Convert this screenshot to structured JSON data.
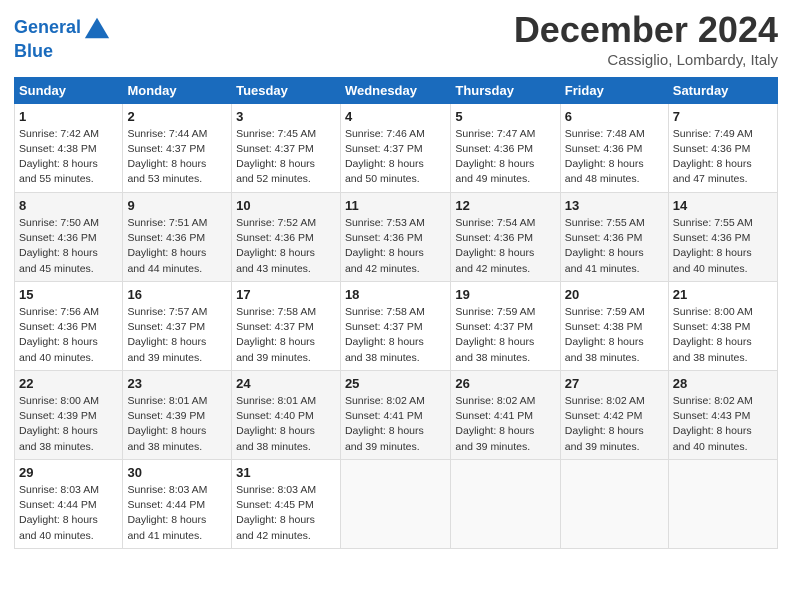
{
  "header": {
    "logo_line1": "General",
    "logo_line2": "Blue",
    "month": "December 2024",
    "location": "Cassiglio, Lombardy, Italy"
  },
  "weekdays": [
    "Sunday",
    "Monday",
    "Tuesday",
    "Wednesday",
    "Thursday",
    "Friday",
    "Saturday"
  ],
  "weeks": [
    [
      {
        "day": "1",
        "info": "Sunrise: 7:42 AM\nSunset: 4:38 PM\nDaylight: 8 hours\nand 55 minutes."
      },
      {
        "day": "2",
        "info": "Sunrise: 7:44 AM\nSunset: 4:37 PM\nDaylight: 8 hours\nand 53 minutes."
      },
      {
        "day": "3",
        "info": "Sunrise: 7:45 AM\nSunset: 4:37 PM\nDaylight: 8 hours\nand 52 minutes."
      },
      {
        "day": "4",
        "info": "Sunrise: 7:46 AM\nSunset: 4:37 PM\nDaylight: 8 hours\nand 50 minutes."
      },
      {
        "day": "5",
        "info": "Sunrise: 7:47 AM\nSunset: 4:36 PM\nDaylight: 8 hours\nand 49 minutes."
      },
      {
        "day": "6",
        "info": "Sunrise: 7:48 AM\nSunset: 4:36 PM\nDaylight: 8 hours\nand 48 minutes."
      },
      {
        "day": "7",
        "info": "Sunrise: 7:49 AM\nSunset: 4:36 PM\nDaylight: 8 hours\nand 47 minutes."
      }
    ],
    [
      {
        "day": "8",
        "info": "Sunrise: 7:50 AM\nSunset: 4:36 PM\nDaylight: 8 hours\nand 45 minutes."
      },
      {
        "day": "9",
        "info": "Sunrise: 7:51 AM\nSunset: 4:36 PM\nDaylight: 8 hours\nand 44 minutes."
      },
      {
        "day": "10",
        "info": "Sunrise: 7:52 AM\nSunset: 4:36 PM\nDaylight: 8 hours\nand 43 minutes."
      },
      {
        "day": "11",
        "info": "Sunrise: 7:53 AM\nSunset: 4:36 PM\nDaylight: 8 hours\nand 42 minutes."
      },
      {
        "day": "12",
        "info": "Sunrise: 7:54 AM\nSunset: 4:36 PM\nDaylight: 8 hours\nand 42 minutes."
      },
      {
        "day": "13",
        "info": "Sunrise: 7:55 AM\nSunset: 4:36 PM\nDaylight: 8 hours\nand 41 minutes."
      },
      {
        "day": "14",
        "info": "Sunrise: 7:55 AM\nSunset: 4:36 PM\nDaylight: 8 hours\nand 40 minutes."
      }
    ],
    [
      {
        "day": "15",
        "info": "Sunrise: 7:56 AM\nSunset: 4:36 PM\nDaylight: 8 hours\nand 40 minutes."
      },
      {
        "day": "16",
        "info": "Sunrise: 7:57 AM\nSunset: 4:37 PM\nDaylight: 8 hours\nand 39 minutes."
      },
      {
        "day": "17",
        "info": "Sunrise: 7:58 AM\nSunset: 4:37 PM\nDaylight: 8 hours\nand 39 minutes."
      },
      {
        "day": "18",
        "info": "Sunrise: 7:58 AM\nSunset: 4:37 PM\nDaylight: 8 hours\nand 38 minutes."
      },
      {
        "day": "19",
        "info": "Sunrise: 7:59 AM\nSunset: 4:37 PM\nDaylight: 8 hours\nand 38 minutes."
      },
      {
        "day": "20",
        "info": "Sunrise: 7:59 AM\nSunset: 4:38 PM\nDaylight: 8 hours\nand 38 minutes."
      },
      {
        "day": "21",
        "info": "Sunrise: 8:00 AM\nSunset: 4:38 PM\nDaylight: 8 hours\nand 38 minutes."
      }
    ],
    [
      {
        "day": "22",
        "info": "Sunrise: 8:00 AM\nSunset: 4:39 PM\nDaylight: 8 hours\nand 38 minutes."
      },
      {
        "day": "23",
        "info": "Sunrise: 8:01 AM\nSunset: 4:39 PM\nDaylight: 8 hours\nand 38 minutes."
      },
      {
        "day": "24",
        "info": "Sunrise: 8:01 AM\nSunset: 4:40 PM\nDaylight: 8 hours\nand 38 minutes."
      },
      {
        "day": "25",
        "info": "Sunrise: 8:02 AM\nSunset: 4:41 PM\nDaylight: 8 hours\nand 39 minutes."
      },
      {
        "day": "26",
        "info": "Sunrise: 8:02 AM\nSunset: 4:41 PM\nDaylight: 8 hours\nand 39 minutes."
      },
      {
        "day": "27",
        "info": "Sunrise: 8:02 AM\nSunset: 4:42 PM\nDaylight: 8 hours\nand 39 minutes."
      },
      {
        "day": "28",
        "info": "Sunrise: 8:02 AM\nSunset: 4:43 PM\nDaylight: 8 hours\nand 40 minutes."
      }
    ],
    [
      {
        "day": "29",
        "info": "Sunrise: 8:03 AM\nSunset: 4:44 PM\nDaylight: 8 hours\nand 40 minutes."
      },
      {
        "day": "30",
        "info": "Sunrise: 8:03 AM\nSunset: 4:44 PM\nDaylight: 8 hours\nand 41 minutes."
      },
      {
        "day": "31",
        "info": "Sunrise: 8:03 AM\nSunset: 4:45 PM\nDaylight: 8 hours\nand 42 minutes."
      },
      null,
      null,
      null,
      null
    ]
  ]
}
